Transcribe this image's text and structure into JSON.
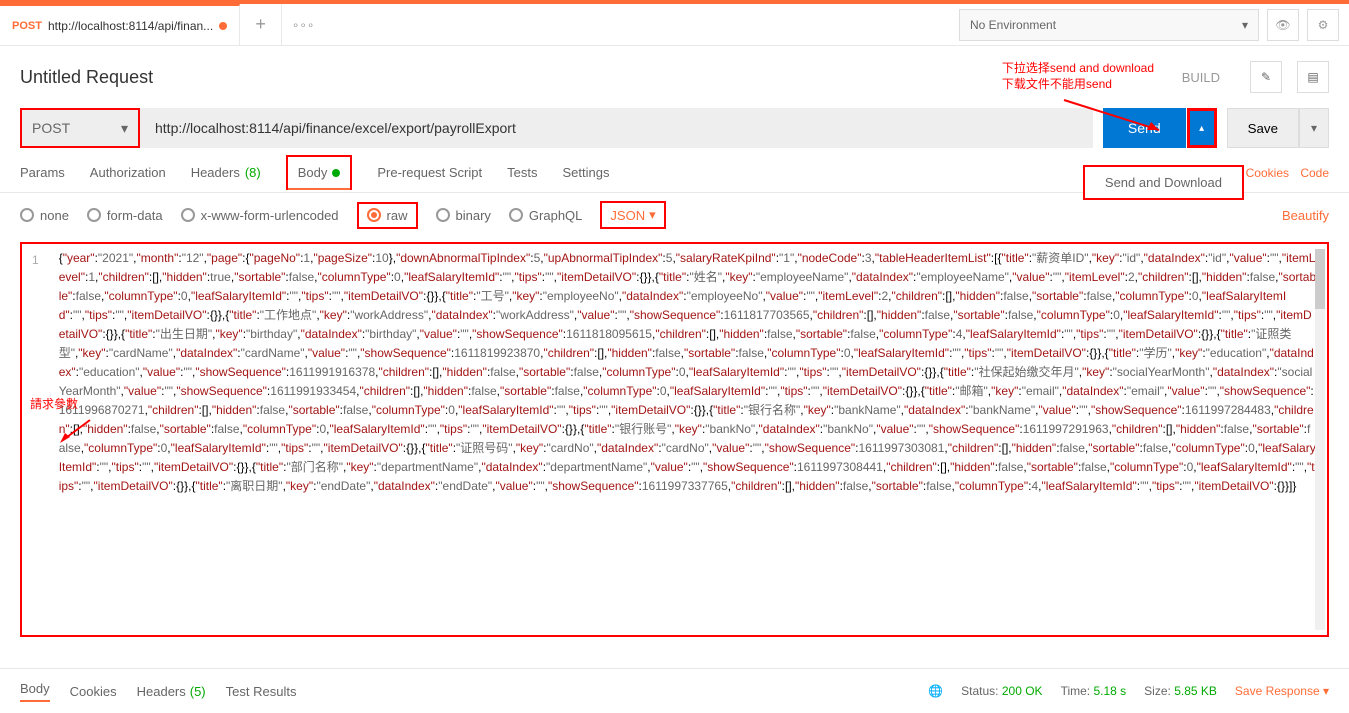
{
  "tab": {
    "method": "POST",
    "title": "http://localhost:8114/api/finan..."
  },
  "env": "No Environment",
  "reqTitle": "Untitled Request",
  "build": "BUILD",
  "method": "POST",
  "url": "http://localhost:8114/api/finance/excel/export/payrollExport",
  "send": "Send",
  "save": "Save",
  "sendDownload": "Send and Download",
  "tabs": {
    "params": "Params",
    "auth": "Authorization",
    "headers": "Headers",
    "headersCount": "(8)",
    "body": "Body",
    "prereq": "Pre-request Script",
    "tests": "Tests",
    "settings": "Settings"
  },
  "cookies": "Cookies",
  "code": "Code",
  "bodyTypes": {
    "none": "none",
    "formdata": "form-data",
    "xwww": "x-www-form-urlencoded",
    "raw": "raw",
    "binary": "binary",
    "graphql": "GraphQL",
    "json": "JSON"
  },
  "beautify": "Beautify",
  "annot1a": "下拉选择send and download",
  "annot1b": "下载文件不能用send",
  "annot2": "請求參數",
  "footer": {
    "body": "Body",
    "cookies": "Cookies",
    "headers": "Headers",
    "headersCount": "(5)",
    "tests": "Test Results",
    "status": "Status:",
    "statusVal": "200 OK",
    "time": "Time:",
    "timeVal": "5.18 s",
    "size": "Size:",
    "sizeVal": "5.85 KB",
    "saveResp": "Save Response"
  },
  "chart_data": {
    "type": "table",
    "request_body": {
      "year": "2021",
      "month": "12",
      "page": {
        "pageNo": 1,
        "pageSize": 10
      },
      "downAbnormalTipIndex": 5,
      "upAbnormalTipIndex": 5,
      "salaryRateKpiInd": "1",
      "nodeCode": 3,
      "tableHeaderItemList": [
        {
          "title": "薪资单ID",
          "key": "id",
          "dataIndex": "id",
          "value": "",
          "itemLevel": 1,
          "children": [],
          "hidden": true,
          "sortable": false,
          "columnType": 0,
          "leafSalaryItemId": "",
          "tips": "",
          "itemDetailVO": {}
        },
        {
          "title": "姓名",
          "key": "employeeName",
          "dataIndex": "employeeName",
          "value": "",
          "itemLevel": 2,
          "children": [],
          "hidden": false,
          "sortable": false,
          "columnType": 0,
          "leafSalaryItemId": "",
          "tips": "",
          "itemDetailVO": {}
        },
        {
          "title": "工号",
          "key": "employeeNo",
          "dataIndex": "employeeNo",
          "value": "",
          "itemLevel": 2,
          "children": [],
          "hidden": false,
          "sortable": false,
          "columnType": 0,
          "leafSalaryItemId": "",
          "tips": "",
          "itemDetailVO": {}
        },
        {
          "title": "工作地点",
          "key": "workAddress",
          "dataIndex": "workAddress",
          "value": "",
          "showSequence": 1611817703565,
          "children": [],
          "hidden": false,
          "sortable": false,
          "columnType": 0,
          "leafSalaryItemId": "",
          "tips": "",
          "itemDetailVO": {}
        },
        {
          "title": "出生日期",
          "key": "birthday",
          "dataIndex": "birthday",
          "value": "",
          "showSequence": 1611818095615,
          "children": [],
          "hidden": false,
          "sortable": false,
          "columnType": 4,
          "leafSalaryItemId": "",
          "tips": "",
          "itemDetailVO": {}
        },
        {
          "title": "证照类型",
          "key": "cardName",
          "dataIndex": "cardName",
          "value": "",
          "showSequence": 1611819923870,
          "children": [],
          "hidden": false,
          "sortable": false,
          "columnType": 0,
          "leafSalaryItemId": "",
          "tips": "",
          "itemDetailVO": {}
        },
        {
          "title": "学历",
          "key": "education",
          "dataIndex": "education",
          "value": "",
          "showSequence": 1611991916378,
          "children": [],
          "hidden": false,
          "sortable": false,
          "columnType": 0,
          "leafSalaryItemId": "",
          "tips": "",
          "itemDetailVO": {}
        },
        {
          "title": "社保起始缴交年月",
          "key": "socialYearMonth",
          "dataIndex": "socialYearMonth",
          "value": "",
          "showSequence": 1611991933454,
          "children": [],
          "hidden": false,
          "sortable": false,
          "columnType": 0,
          "leafSalaryItemId": "",
          "tips": "",
          "itemDetailVO": {}
        },
        {
          "title": "邮箱",
          "key": "email",
          "dataIndex": "email",
          "value": "",
          "showSequence": 1611996870271,
          "children": [],
          "hidden": false,
          "sortable": false,
          "columnType": 0,
          "leafSalaryItemId": "",
          "tips": "",
          "itemDetailVO": {}
        },
        {
          "title": "银行名称",
          "key": "bankName",
          "dataIndex": "bankName",
          "value": "",
          "showSequence": 1611997284483,
          "children": [],
          "hidden": false,
          "sortable": false,
          "columnType": 0,
          "leafSalaryItemId": "",
          "tips": "",
          "itemDetailVO": {}
        },
        {
          "title": "银行账号",
          "key": "bankNo",
          "dataIndex": "bankNo",
          "value": "",
          "showSequence": 1611997291963,
          "children": [],
          "hidden": false,
          "sortable": false,
          "columnType": 0,
          "leafSalaryItemId": "",
          "tips": "",
          "itemDetailVO": {}
        },
        {
          "title": "证照号码",
          "key": "cardNo",
          "dataIndex": "cardNo",
          "value": "",
          "showSequence": 1611997303081,
          "children": [],
          "hidden": false,
          "sortable": false,
          "columnType": 0,
          "leafSalaryItemId": "",
          "tips": "",
          "itemDetailVO": {}
        },
        {
          "title": "部门名称",
          "key": "departmentName",
          "dataIndex": "departmentName",
          "value": "",
          "showSequence": 1611997308441,
          "children": [],
          "hidden": false,
          "sortable": false,
          "columnType": 0,
          "leafSalaryItemId": "",
          "tips": "",
          "itemDetailVO": {}
        },
        {
          "title": "离职日期",
          "key": "endDate",
          "dataIndex": "endDate",
          "value": "",
          "showSequence": 1611997337765,
          "children": [],
          "hidden": false,
          "sortable": false,
          "columnType": 4,
          "leafSalaryItemId": "",
          "tips": "",
          "itemDetailVO": {}
        }
      ]
    }
  }
}
